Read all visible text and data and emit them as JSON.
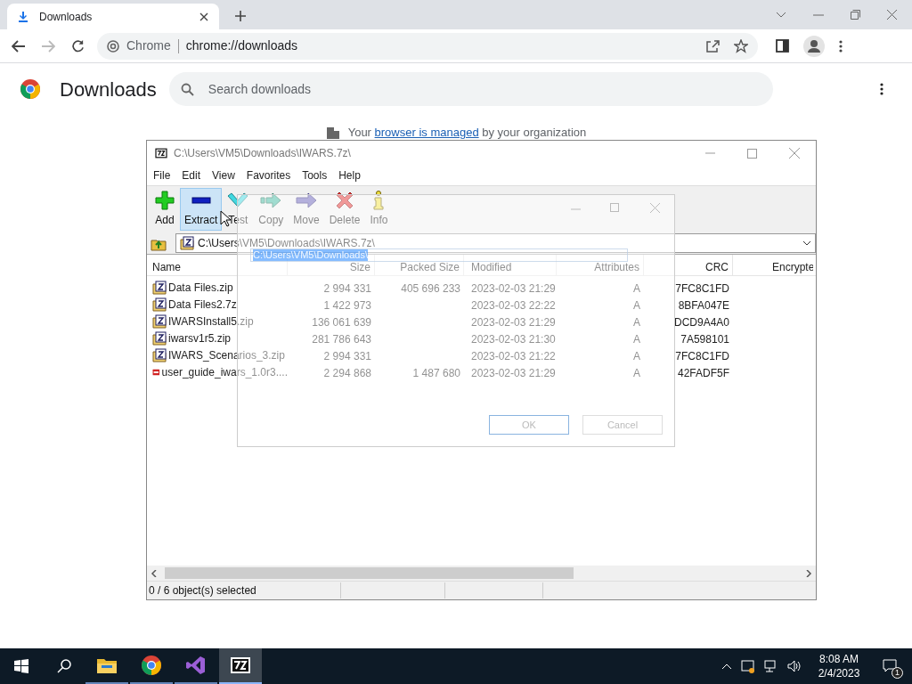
{
  "browser": {
    "tab_title": "Downloads",
    "origin_label": "Chrome",
    "url": "chrome://downloads",
    "page_title": "Downloads",
    "search_placeholder": "Search downloads",
    "managed_notice": {
      "before": "Your",
      "link": "browser is managed",
      "after": "by your organization"
    }
  },
  "archive_window": {
    "title": "C:\\Users\\VM5\\Downloads\\IWARS.7z\\",
    "menu": [
      "File",
      "Edit",
      "View",
      "Favorites",
      "Tools",
      "Help"
    ],
    "toolbar": [
      {
        "label": "Add",
        "kind": "add",
        "highlighted": false
      },
      {
        "label": "Extract",
        "kind": "extract",
        "highlighted": true
      },
      {
        "label": "Test",
        "kind": "test",
        "highlighted": false
      },
      {
        "label": "Copy",
        "kind": "copy",
        "highlighted": false
      },
      {
        "label": "Move",
        "kind": "move",
        "highlighted": false
      },
      {
        "label": "Delete",
        "kind": "delete",
        "highlighted": false
      },
      {
        "label": "Info",
        "kind": "info",
        "highlighted": false
      }
    ],
    "path": "C:\\Users\\VM5\\Downloads\\IWARS.7z\\",
    "columns": [
      "Name",
      "Size",
      "Packed Size",
      "Modified",
      "Attributes",
      "CRC",
      "Encrypte"
    ],
    "rows": [
      {
        "kind": "archive",
        "name": "Data Files.zip",
        "size": "2 994 331",
        "packed_size": "405 696 233",
        "modified": "2023-02-03 21:29",
        "attributes": "A",
        "crc": "7FC8C1FD"
      },
      {
        "kind": "archive",
        "name": "Data Files2.7z",
        "size": "1 422 973",
        "modified": "2023-02-03 22:22",
        "attributes": "A",
        "crc": "8BFA047E"
      },
      {
        "kind": "archive",
        "name": "IWARSInstall5.zip",
        "size": "136 061 639",
        "modified": "2023-02-03 21:29",
        "attributes": "A",
        "crc": "DCD9A4A0"
      },
      {
        "kind": "archive",
        "name": "iwarsv1r5.zip",
        "size": "281 786 643",
        "modified": "2023-02-03 21:30",
        "attributes": "A",
        "crc": "7A598101"
      },
      {
        "kind": "archive",
        "name": "IWARS_Scenarios_3.zip",
        "size": "2 994 331",
        "modified": "2023-02-03 21:22",
        "attributes": "A",
        "crc": "7FC8C1FD"
      },
      {
        "kind": "pdf",
        "name": "user_guide_iwars_1.0r3....",
        "size": "2 294 868",
        "packed_size": "1 487 680",
        "modified": "2023-02-03 21:29",
        "attributes": "A",
        "crc": "42FADF5F"
      }
    ],
    "status": "0 / 6 object(s) selected"
  },
  "copy_dialog": {
    "destination": "C:\\Users\\VM5\\Downloads\\",
    "buttons": [
      "OK",
      "Cancel"
    ]
  },
  "taskbar": {
    "apps": [
      {
        "kind": "explorer",
        "selected": false
      },
      {
        "kind": "chrome",
        "selected": false
      },
      {
        "kind": "studio",
        "selected": false
      },
      {
        "kind": "sevenzip",
        "selected": true
      }
    ],
    "time": "8:08 AM",
    "date": "2/4/2023",
    "notification_count": "1"
  }
}
